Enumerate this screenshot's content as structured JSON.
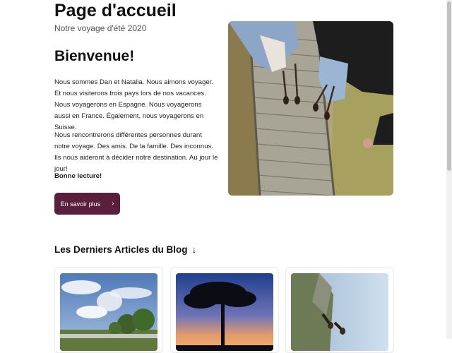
{
  "header": {
    "title": "Page d'accueil",
    "subtitle": "Notre voyage d'été 2020"
  },
  "intro": {
    "heading": "Bienvenue!",
    "paragraph_1": "Nous sommes Dan et Natalia. Nous aimons voyager. Et nous visiterons trois pays lors de nos vacances. Nous voyagerons en Espagne. Nous voyagerons aussi en France. Également, nous voyagerons en Suisse.",
    "paragraph_2": "Nous rencontrerons différentes personnes durant notre voyage. Des amis. De la famille. Des inconnus. Ils nous aideront à décider notre destination. Au jour le jour!",
    "sign_off": "Bonne lecture!",
    "cta_label": "En savoir plus",
    "cta_icon": "chevron-right-icon"
  },
  "hero_image": {
    "description_icon": "photo-boardwalk-feet"
  },
  "blog": {
    "section_title": "Les Derniers Articles du Blog",
    "section_icon": "arrow-down-icon",
    "cards": [
      {
        "icon": "photo-sky-clouds-trees"
      },
      {
        "icon": "photo-tree-sunset"
      },
      {
        "icon": "photo-mountain-feet"
      }
    ]
  },
  "colors": {
    "accent": "#5a1f3c",
    "text": "#111111",
    "muted": "#555555"
  }
}
